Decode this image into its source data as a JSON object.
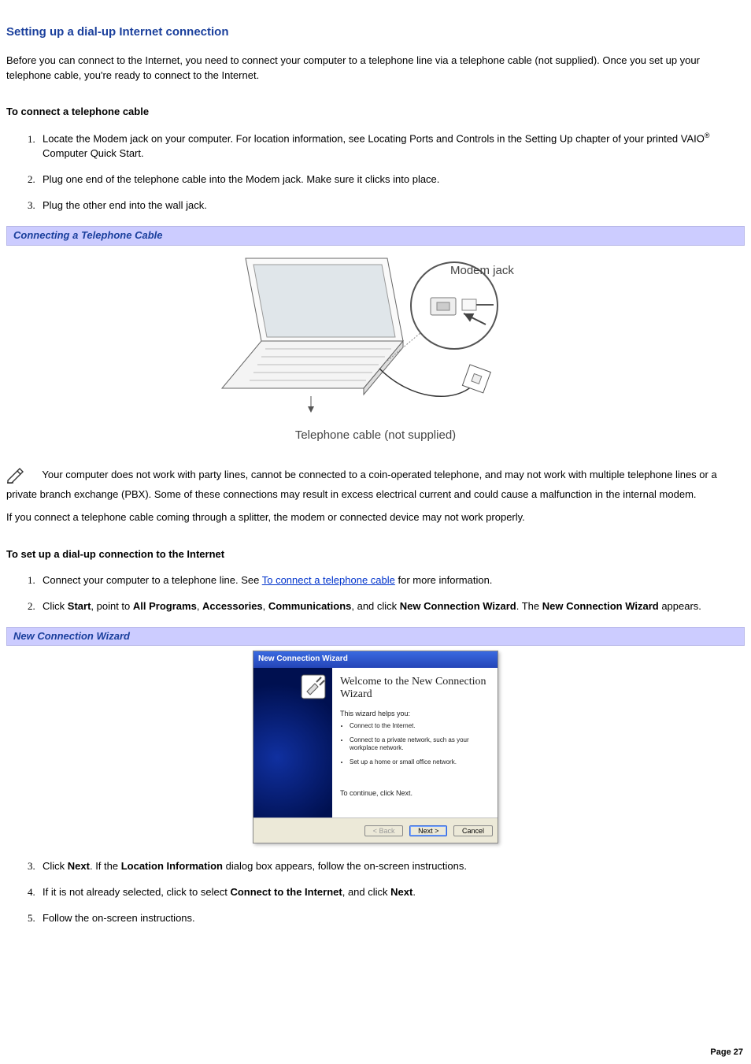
{
  "heading": "Setting up a dial-up Internet connection",
  "intro": "Before you can connect to the Internet, you need to connect your computer to a telephone line via a telephone cable (not supplied). Once you set up your telephone cable, you're ready to connect to the Internet.",
  "connect_cable": {
    "title": "To connect a telephone cable",
    "steps": {
      "s1a": "Locate the Modem jack on your computer. For location information, see Locating Ports and Controls in the Setting Up chapter of your printed VAIO",
      "s1b": " Computer Quick Start.",
      "reg": "®",
      "s2": "Plug one end of the telephone cable into the Modem jack. Make sure it clicks into place.",
      "s3": "Plug the other end into the wall jack."
    }
  },
  "band1": "Connecting a Telephone Cable",
  "diagram1": {
    "label_modem": "Modem jack",
    "caption": "Telephone cable (not supplied)"
  },
  "note1": "Your computer does not work with party lines, cannot be connected to a coin-operated telephone, and may not work with multiple telephone lines or a private branch exchange (PBX). Some of these connections may result in excess electrical current and could cause a malfunction in the internal modem.",
  "note2": "If you connect a telephone cable coming through a splitter, the modem or connected device may not work properly.",
  "setup_dialup": {
    "title": "To set up a dial-up connection to the Internet",
    "s1_pre": "Connect your computer to a telephone line. See ",
    "s1_link": "To connect a telephone cable",
    "s1_post": " for more information.",
    "s2": {
      "pre": "Click ",
      "start": "Start",
      "mid1": ", point to ",
      "allprograms": "All Programs",
      "sep": ", ",
      "accessories": "Accessories",
      "communications": "Communications",
      "mid2": ", and click ",
      "ncw": "New Connection Wizard",
      "post": ". The ",
      "ncw2": "New Connection Wizard",
      "appears": " appears."
    }
  },
  "band2": "New Connection Wizard",
  "wizard": {
    "titlebar": "New Connection Wizard",
    "welcome": "Welcome to the New Connection Wizard",
    "helps": "This wizard helps you:",
    "items": {
      "i1": "Connect to the Internet.",
      "i2": "Connect to a private network, such as your workplace network.",
      "i3": "Set up a home or small office network."
    },
    "cont": "To continue, click Next.",
    "back": "< Back",
    "next": "Next >",
    "cancel": "Cancel"
  },
  "steps_after": {
    "s3": {
      "pre": "Click ",
      "next": "Next",
      "mid": ". If the ",
      "loc": "Location Information",
      "post": " dialog box appears, follow the on-screen instructions."
    },
    "s4": {
      "pre": "If it is not already selected, click to select ",
      "connect": "Connect to the Internet",
      "mid": ", and click ",
      "next": "Next",
      "post": "."
    },
    "s5": "Follow the on-screen instructions."
  },
  "footer": "Page 27"
}
